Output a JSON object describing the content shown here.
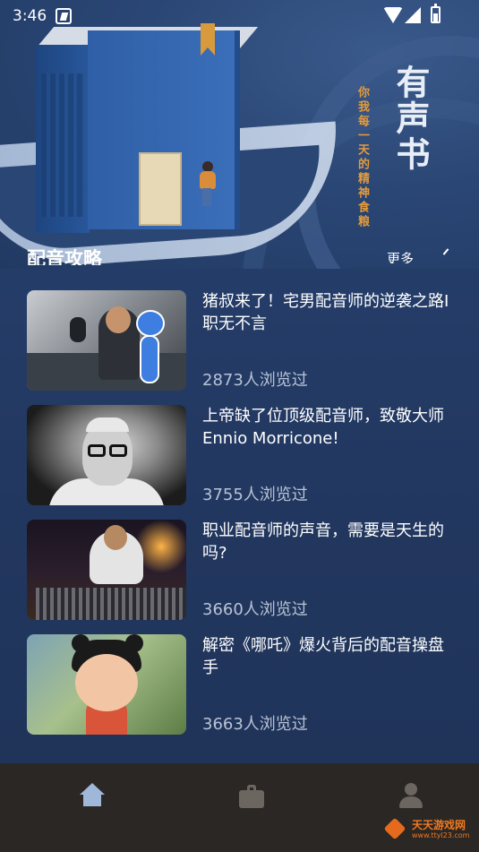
{
  "status_bar": {
    "time": "3:46"
  },
  "banner": {
    "title": "有声书",
    "subtitle": "你我每一天的精神食粮"
  },
  "section": {
    "title": "配音攻略",
    "more": "更多"
  },
  "articles": [
    {
      "title": "猪叔来了！宅男配音师的逆袭之路I 职无不言",
      "views": "2873人浏览过"
    },
    {
      "title": "上帝缺了位顶级配音师，致敬大师Ennio Morricone!",
      "views": "3755人浏览过"
    },
    {
      "title": "职业配音师的声音，需要是天生的吗?",
      "views": "3660人浏览过"
    },
    {
      "title": "解密《哪吒》爆火背后的配音操盘手",
      "views": "3663人浏览过"
    }
  ],
  "nav": {
    "items": [
      {
        "icon": "home-icon",
        "active": true
      },
      {
        "icon": "briefcase-icon",
        "active": false
      },
      {
        "icon": "user-icon",
        "active": false
      }
    ],
    "colors": {
      "active": "#9fb7d8",
      "inactive": "#6b6660",
      "background": "#2b2724"
    }
  },
  "watermark": {
    "name": "天天游戏网",
    "url": "www.ttyl23.com"
  }
}
